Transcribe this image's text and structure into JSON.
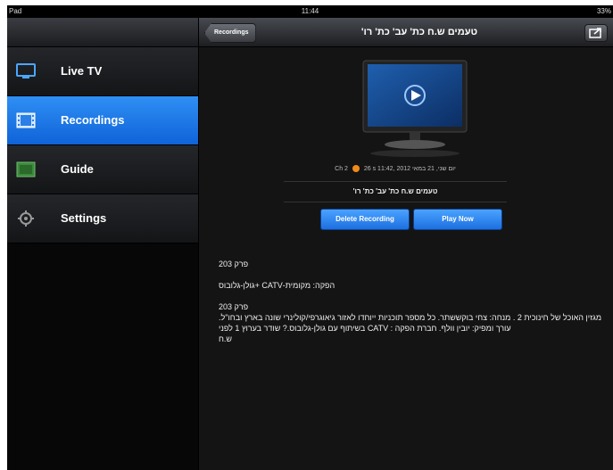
{
  "status_bar": {
    "carrier": "Pad",
    "time": "11:44",
    "battery": "33%"
  },
  "sidebar": {
    "items": [
      {
        "label": "Live TV",
        "icon": "tv-icon",
        "active": false
      },
      {
        "label": "Recordings",
        "icon": "film-icon",
        "active": true
      },
      {
        "label": "Guide",
        "icon": "guide-icon",
        "active": false
      },
      {
        "label": "Settings",
        "icon": "gear-icon",
        "active": false
      }
    ]
  },
  "navbar": {
    "back_label": "Recordings",
    "title": "טעמים  ש.ח כת' עב' כת' רו'",
    "share_icon": "share-icon"
  },
  "detail": {
    "meta_text": "יום שני, 21 במאי 2012 ,11:42 Ch 2",
    "duration": "26 s",
    "program_title": "טעמים  ש.ח כת' עב' כת' רו'",
    "delete_label": "Delete Recording",
    "play_label": "Play Now",
    "description": [
      "פרק 203",
      "הפקה: מקומית-CATV +גולן-גלובוס",
      "פרק 203\nמגזין האוכל של חינוכית 2 . מנחה: צחי בוקששתר.   כל מספר תוכניות ייוחדו לאזור גיאוגרפי/קולינרי שונה בארץ ובחו\"ל.   עורך ומפיק: יובין וולף. חברת הפקה : CATV בשיתוף עם גולן-גלובוס.?  שודר בערוץ 1 לפני\nש.ח"
    ]
  },
  "colors": {
    "accent": "#1f7ee8",
    "button": "#2a85f0"
  }
}
